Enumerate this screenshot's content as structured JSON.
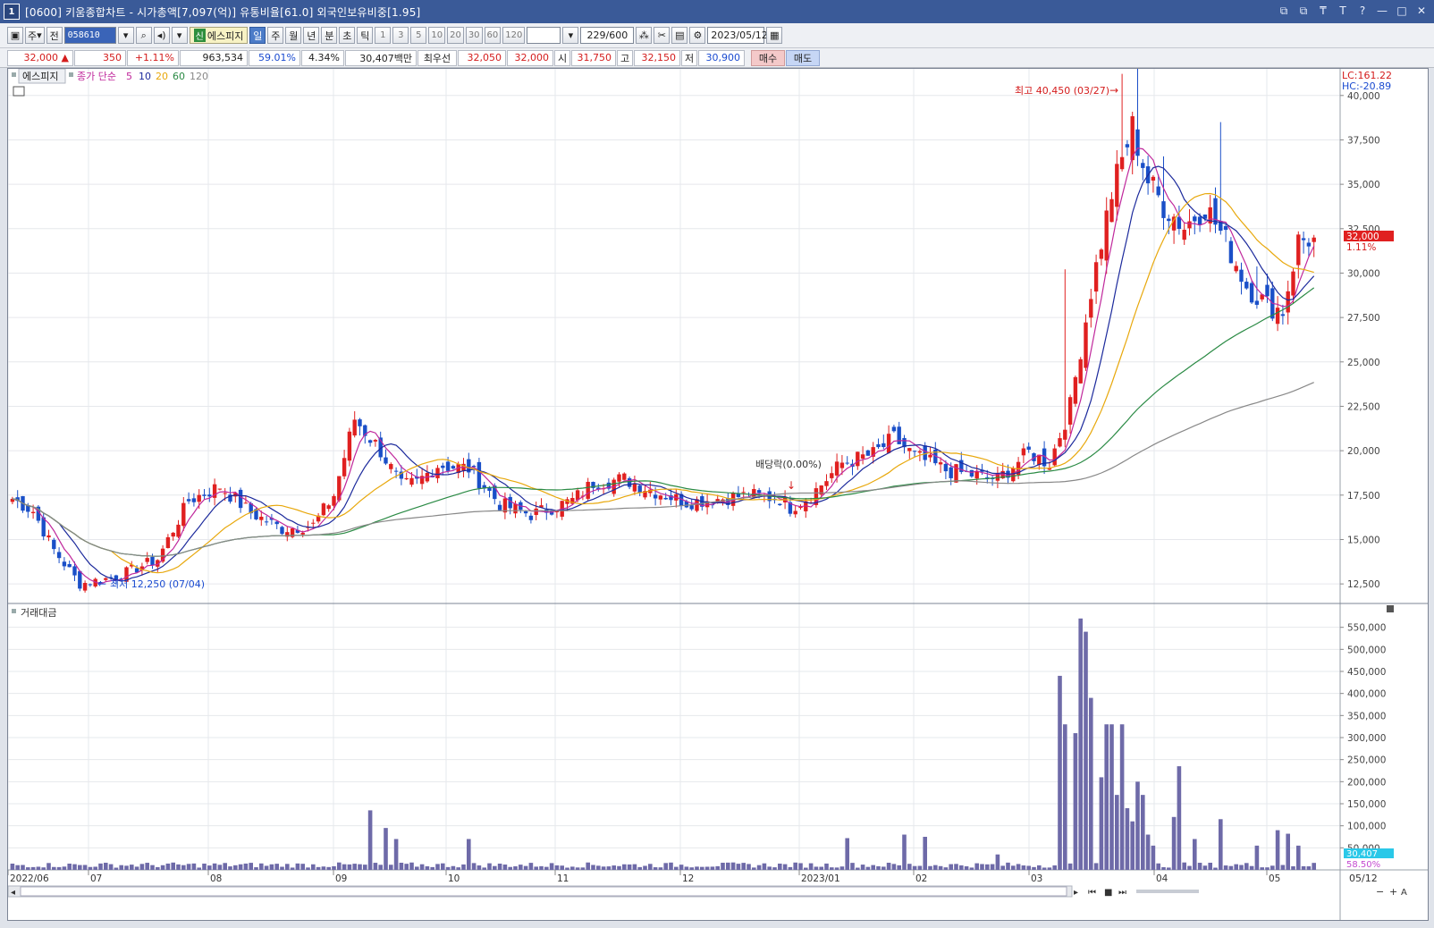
{
  "title": {
    "window_num": "1",
    "text": "[0600] 키움종합차트 - 시가총액[7,097(억)] 유통비율[61.0] 외국인보유비중[1.95]",
    "controls": [
      "⧉",
      "⧉",
      "₸",
      "T",
      "?",
      "—",
      "□",
      "✕"
    ]
  },
  "toolbar": {
    "period_week": "주",
    "full": "전",
    "code": "058610",
    "stock_name": "에스피지",
    "sin_badge": "신",
    "tf_day": "일",
    "tf_week": "주",
    "tf_month": "월",
    "tf_year": "년",
    "tf_min": "분",
    "tf_sec": "초",
    "tf_tick": "틱",
    "intervals": [
      "1",
      "3",
      "5",
      "10",
      "20",
      "30",
      "60",
      "120"
    ],
    "count": "229",
    "count_max": "/600",
    "date": "2023/05/12"
  },
  "quote": {
    "price": "32,000",
    "change": "350",
    "change_pct": "+1.11%",
    "volume": "963,534",
    "vol_ratio": "59.01%",
    "turnover_pct": "4.34%",
    "amount": "30,407백만",
    "best_ask_label": "최우선",
    "ask": "32,050",
    "bid": "32,000",
    "open_label": "시",
    "open": "31,750",
    "high_label": "고",
    "high": "32,150",
    "low_label": "저",
    "low": "30,900",
    "buy": "매수",
    "sell": "매도"
  },
  "chart": {
    "stock_label": "에스피지",
    "ma_label": "종가 단순",
    "ma_periods": [
      {
        "p": "5",
        "color": "#c0289c"
      },
      {
        "p": "10",
        "color": "#1c2a9c"
      },
      {
        "p": "20",
        "color": "#e8a80c"
      },
      {
        "p": "60",
        "color": "#2a8a44"
      },
      {
        "p": "120",
        "color": "#888888"
      }
    ],
    "lc": "LC:161.22",
    "hc": "HC:-20.89",
    "price_ticks": [
      "40,000",
      "37,500",
      "35,000",
      "32,500",
      "30,000",
      "27,500",
      "25,000",
      "22,500",
      "20,000",
      "17,500",
      "15,000",
      "12,500"
    ],
    "current_price": "32,000",
    "current_pct": "1.11%",
    "high_annotation": "최고 40,450 (03/27)",
    "low_annotation": "최저 12,250 (07/04)",
    "dividend_annotation": "배당락(0.00%)",
    "volume_label": "거래대금",
    "volume_ticks": [
      "550,000",
      "500,000",
      "450,000",
      "400,000",
      "350,000",
      "300,000",
      "250,000",
      "200,000",
      "150,000",
      "100,000",
      "50,000"
    ],
    "volume_current": "30,407",
    "volume_pct": "58.50%",
    "month_labels": [
      "2022/06",
      "07",
      "08",
      "09",
      "10",
      "11",
      "12",
      "2023/01",
      "02",
      "03",
      "04",
      "05"
    ],
    "date_label": "05/12",
    "up_color": "#e02020",
    "down_color": "#1a4fc8",
    "vol_color": "#6e6aa8"
  },
  "chart_data": {
    "type": "candlestick",
    "ylim": [
      11500,
      41500
    ],
    "vol_ylim": [
      0,
      600000
    ],
    "price_anchors": [
      [
        0,
        17300
      ],
      [
        4,
        16600
      ],
      [
        8,
        14400
      ],
      [
        13,
        12500
      ],
      [
        20,
        12900
      ],
      [
        28,
        13900
      ],
      [
        34,
        17200
      ],
      [
        40,
        18000
      ],
      [
        46,
        16500
      ],
      [
        52,
        15600
      ],
      [
        58,
        15800
      ],
      [
        62,
        17500
      ],
      [
        66,
        21800
      ],
      [
        71,
        20000
      ],
      [
        75,
        18000
      ],
      [
        78,
        18200
      ],
      [
        82,
        19200
      ],
      [
        88,
        19000
      ],
      [
        94,
        17000
      ],
      [
        100,
        16400
      ],
      [
        104,
        16800
      ],
      [
        108,
        17200
      ],
      [
        112,
        18200
      ],
      [
        118,
        18400
      ],
      [
        124,
        17700
      ],
      [
        130,
        17100
      ],
      [
        136,
        17300
      ],
      [
        142,
        17500
      ],
      [
        148,
        17300
      ],
      [
        150,
        16800
      ],
      [
        154,
        17500
      ],
      [
        160,
        19300
      ],
      [
        166,
        19800
      ],
      [
        170,
        20700
      ],
      [
        174,
        19700
      ],
      [
        180,
        18900
      ],
      [
        186,
        18600
      ],
      [
        190,
        18400
      ],
      [
        196,
        19900
      ],
      [
        200,
        19300
      ],
      [
        204,
        22500
      ],
      [
        208,
        29000
      ],
      [
        212,
        34500
      ],
      [
        216,
        38200
      ],
      [
        219,
        35200
      ],
      [
        222,
        33800
      ],
      [
        226,
        32600
      ],
      [
        230,
        33800
      ],
      [
        234,
        31800
      ],
      [
        238,
        29300
      ],
      [
        242,
        28200
      ],
      [
        245,
        27900
      ],
      [
        248,
        31800
      ],
      [
        251,
        32000
      ]
    ],
    "spikes": {
      "203": 9000,
      "214": 4000,
      "217": 6000,
      "222": 2200,
      "233": 5500,
      "240": 1800
    },
    "volume_spikes": {
      "69": 135000,
      "72": 95000,
      "74": 70000,
      "88": 70000,
      "161": 72000,
      "172": 80000,
      "176": 75000,
      "190": 35000,
      "202": 440000,
      "203": 330000,
      "205": 310000,
      "206": 570000,
      "207": 540000,
      "208": 390000,
      "210": 210000,
      "211": 330000,
      "212": 330000,
      "213": 170000,
      "214": 330000,
      "215": 140000,
      "216": 110000,
      "217": 200000,
      "218": 170000,
      "219": 80000,
      "220": 55000,
      "224": 120000,
      "225": 235000,
      "228": 70000,
      "233": 115000,
      "240": 55000,
      "244": 90000,
      "246": 82000,
      "248": 55000
    },
    "month_x": [
      8,
      98,
      232,
      372,
      498,
      620,
      760,
      893,
      1021,
      1150,
      1290,
      1416
    ]
  }
}
